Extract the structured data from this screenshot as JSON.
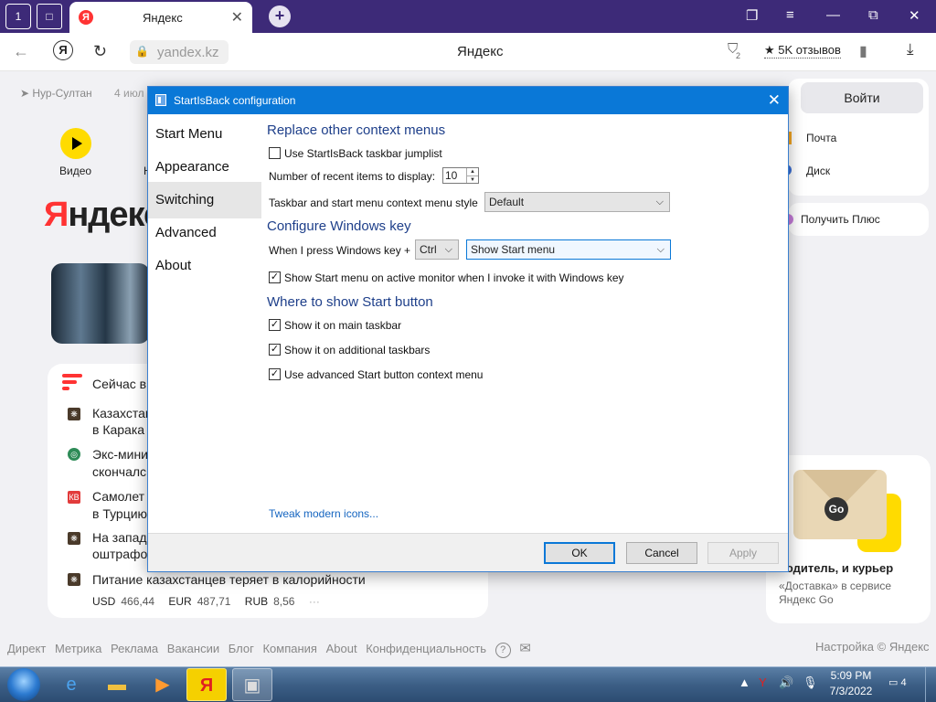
{
  "browser": {
    "tab_title": "Яндекс",
    "tab_favicon": "Я",
    "tab_count_badge": "1",
    "url": "yandex.kz",
    "page_title": "Яндекс",
    "reviews": "★ 5K отзывов",
    "shield_count": "2"
  },
  "page": {
    "city": "Нур-Султан",
    "date": "4 июл",
    "video_label": "Видео",
    "n_label": "Н",
    "logo_red": "Я",
    "logo_rest": "ндекс",
    "news_title": "Сейчас в",
    "news": [
      {
        "line1": "Казахстан",
        "line2": "в Карака"
      },
      {
        "line1": "Экс-мини",
        "line2": "скончалс"
      },
      {
        "line1": "Самолет",
        "line2": "в Турцию"
      },
      {
        "line1": "На запад",
        "line2": "оштрафо"
      },
      {
        "line1": "Питание казахстанцев теряет в калорийности",
        "line2": ""
      }
    ],
    "rates": [
      {
        "code": "USD",
        "value": "466,44"
      },
      {
        "code": "EUR",
        "value": "487,71"
      },
      {
        "code": "RUB",
        "value": "8,56"
      }
    ],
    "rates_more": "···",
    "login": "Войти",
    "mail": "Почта",
    "disk": "Диск",
    "plus": "Получить Плюс",
    "go_title": "водитель, и курьер",
    "go_text1": "«Доставка» в сервисе",
    "go_text2": "Яндекс Go",
    "go_badge": "Go",
    "footer_links": [
      "Директ",
      "Метрика",
      "Реклама",
      "Вакансии",
      "Блог",
      "Компания",
      "About",
      "Конфиденциальность"
    ],
    "footer_settings": "Настройка",
    "footer_copyright": "© Яндекс"
  },
  "dialog": {
    "title": "StartIsBack configuration",
    "nav": [
      "Start Menu",
      "Appearance",
      "Switching",
      "Advanced",
      "About"
    ],
    "selected_nav": "Switching",
    "sec_context": "Replace other context menus",
    "use_jumplist": "Use StartIsBack taskbar jumplist",
    "recent_label": "Number of recent items to display:",
    "recent_value": "10",
    "ctx_style_label": "Taskbar and start menu context menu style",
    "ctx_style_value": "Default",
    "sec_winkey": "Configure Windows key",
    "winkey_label": "When I press Windows key +",
    "winkey_mod": "Ctrl",
    "winkey_action": "Show Start menu",
    "active_monitor": "Show Start menu on active monitor when I invoke it with Windows key",
    "sec_startbtn": "Where to show Start button",
    "main_taskbar": "Show it on main taskbar",
    "additional_taskbars": "Show it on additional taskbars",
    "advanced_ctx": "Use advanced Start button context menu",
    "tweak_link": "Tweak modern icons...",
    "ok": "OK",
    "cancel": "Cancel",
    "apply": "Apply",
    "checks": {
      "use_jumplist": false,
      "active_monitor": true,
      "main_taskbar": true,
      "additional_taskbars": true,
      "advanced_ctx": true
    },
    "check_glyph": "✓"
  },
  "taskbar": {
    "time": "5:09 PM",
    "date": "7/3/2022",
    "notifications": "4"
  },
  "colors": {
    "browser_tabbar": "#3d2a78",
    "dialog_titlebar": "#0a78d7",
    "section_heading": "#1e3f8a",
    "yandex_red": "#ff3333",
    "yandex_yellow": "#ffdb00"
  }
}
